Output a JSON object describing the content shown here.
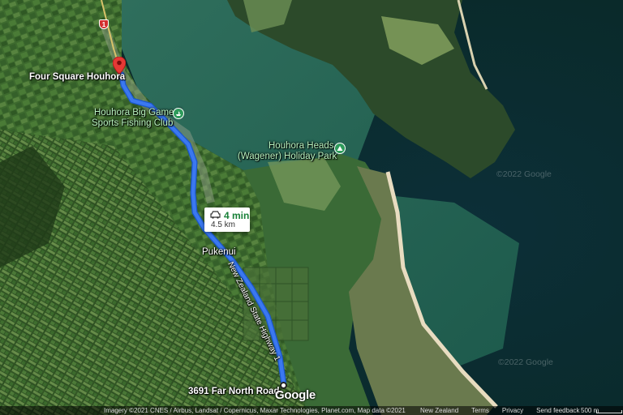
{
  "places": {
    "origin": "Four Square Houhora",
    "destination": "3691 Far North Road",
    "poi1_line1": "Houhora Big Game &",
    "poi1_line2": "Sports Fishing Club",
    "poi2_line1": "Houhora Heads",
    "poi2_line2": "(Wagener) Holiday Park",
    "locality": "Pukenui",
    "road": "New Zealand State Highway 1",
    "road_shield": "1"
  },
  "route": {
    "duration": "4 min",
    "distance": "4.5 km",
    "color": "#3b78f0"
  },
  "watermarks": {
    "a": "©2022 Google",
    "b": "©2022 Google"
  },
  "footer": {
    "logo": "Google",
    "imagery": "Imagery ©2021 CNES / Airbus, Landsat / Copernicus, Maxar Technologies, Planet.com, Map data ©2021",
    "region": "New Zealand",
    "terms": "Terms",
    "privacy": "Privacy",
    "feedback": "Send feedback",
    "scale": "500 m"
  },
  "colors": {
    "pin": "#e53935",
    "poi": "#2e9b5b"
  },
  "icons": {
    "pin": "map-pin-icon",
    "poi1": "boat-icon",
    "poi2": "campground-icon",
    "mode": "car-icon"
  }
}
